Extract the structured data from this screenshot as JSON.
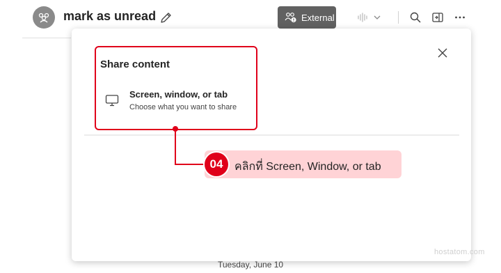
{
  "header": {
    "title": "mark as unread",
    "external_label": "External",
    "icons": {
      "avatar": "group-icon",
      "edit": "pencil-icon",
      "external": "people-lock-icon",
      "call": "audio-wave-icon",
      "call_menu": "chevron-down-icon",
      "search": "search-icon",
      "popout": "pop-out-icon",
      "more": "more-icon"
    }
  },
  "share_panel": {
    "title": "Share content",
    "option": {
      "title": "Screen, window, or tab",
      "subtitle": "Choose what you want to share",
      "icon": "monitor-icon"
    },
    "close_icon": "close-icon"
  },
  "annotation": {
    "step": "04",
    "text": "คลิกที่ Screen, Window, or tab",
    "color": "#e0001a",
    "pill_color": "#ffd3d6"
  },
  "timeline": {
    "date": "Tuesday, June 10"
  },
  "watermark": "hostatom.com",
  "colors": {
    "external_button": "#616161",
    "avatar": "#8a8a8a"
  }
}
